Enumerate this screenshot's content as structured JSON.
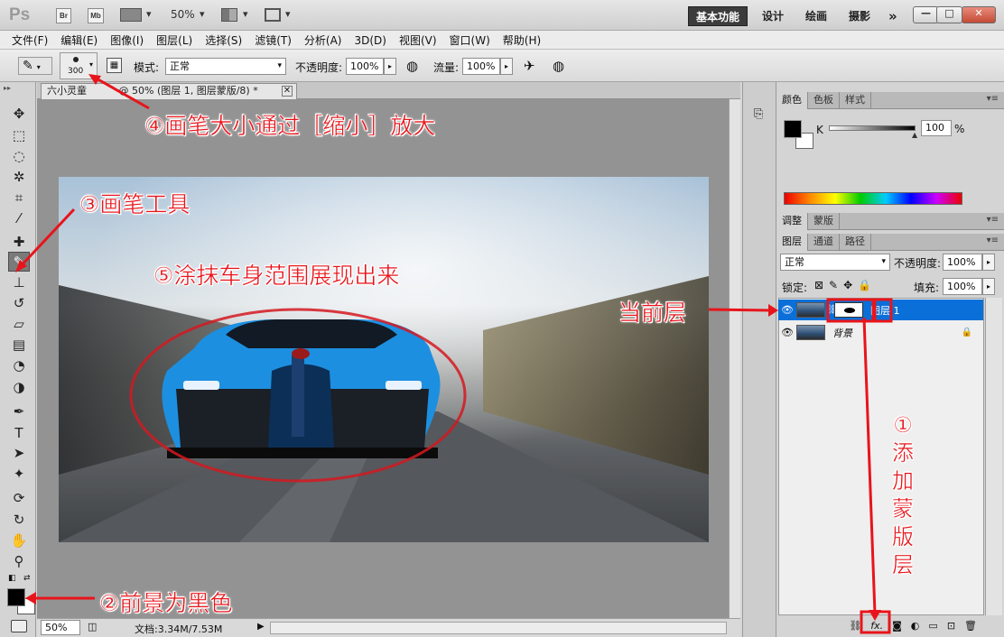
{
  "titlebar": {
    "logo": "Ps",
    "br": "Br",
    "mb": "Mb",
    "zoom": "50%",
    "workspaces": [
      "基本功能",
      "设计",
      "绘画",
      "摄影"
    ],
    "more": "»",
    "win_min": "—",
    "win_max": "□",
    "win_close": "✕"
  },
  "menubar": [
    "文件(F)",
    "编辑(E)",
    "图像(I)",
    "图层(L)",
    "选择(S)",
    "滤镜(T)",
    "分析(A)",
    "3D(D)",
    "视图(V)",
    "窗口(W)",
    "帮助(H)"
  ],
  "options": {
    "brush_size": "300",
    "mode_label": "模式:",
    "mode_value": "正常",
    "opacity_label": "不透明度:",
    "opacity_value": "100%",
    "flow_label": "流量:",
    "flow_value": "100%"
  },
  "document": {
    "tab_prefix": "六小灵童",
    "tab_title": "@ 50% (图层 1, 图层蒙版/8) *",
    "tab_close": "✕",
    "zoom": "50%",
    "doc_size": "文档:3.34M/7.53M"
  },
  "panels": {
    "color_tabs": [
      "颜色",
      "色板",
      "样式"
    ],
    "k_label": "K",
    "k_value": "100",
    "k_unit": "%",
    "adjust_tabs": [
      "调整",
      "蒙版"
    ],
    "layer_tabs": [
      "图层",
      "通道",
      "路径"
    ],
    "blend_mode": "正常",
    "opacity_label": "不透明度:",
    "opacity_value": "100%",
    "lock_label": "锁定:",
    "fill_label": "填充:",
    "fill_value": "100%",
    "layers": [
      {
        "name": "图层 1",
        "selected": true
      },
      {
        "name": "背景",
        "selected": false
      }
    ],
    "bottom_fx": "fx."
  },
  "annotations": {
    "step1": "①添加蒙版层",
    "step2": "②前景为黑色",
    "step3": "③画笔工具",
    "step4": "④画笔大小通过［缩小］放大",
    "step5": "⑤涂抹车身范围展现出来",
    "current": "当前层"
  },
  "colors": {
    "annotation": "#e8141b",
    "selection": "#0a6fd8",
    "car_body": "#1d8fe0"
  }
}
